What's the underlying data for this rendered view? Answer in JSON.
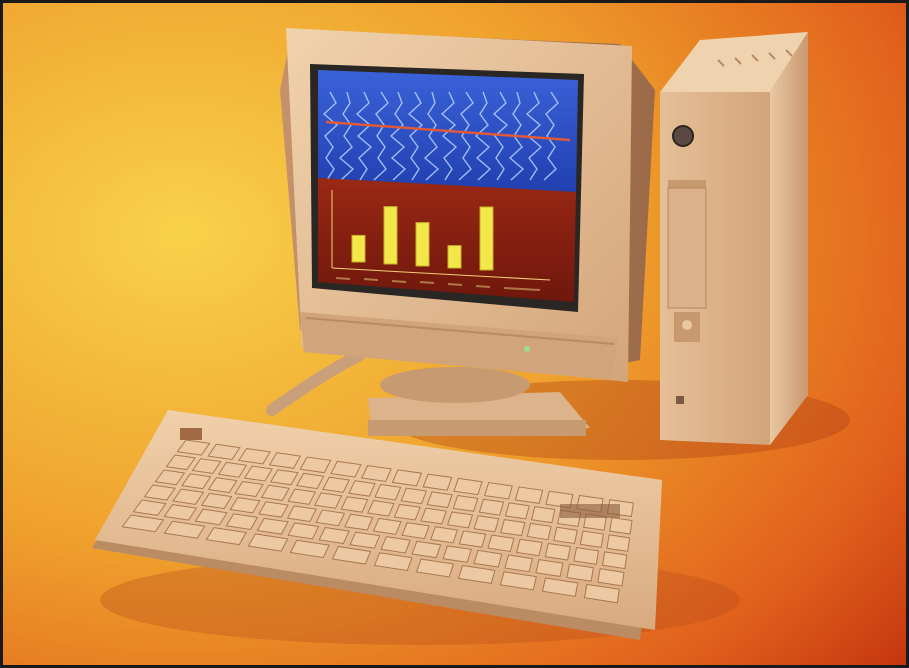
{
  "image": {
    "subject": "",
    "colors": {
      "backdrop_warm": "#f6c23a",
      "backdrop_hot": "#d4380f",
      "beige": "#e9c7a0",
      "beige_shadow": "#b98a63",
      "screen_top": "#2a50c8",
      "screen_bottom": "#8a1d10",
      "bar": "#f2e84a"
    }
  },
  "screen_chart": {
    "bars": [
      0.38,
      0.82,
      0.62,
      0.32,
      0.9
    ],
    "top_panel_lines": 14
  },
  "keyboard": {
    "rows": 6,
    "keys_per_row": [
      15,
      18,
      18,
      17,
      16,
      12
    ]
  }
}
